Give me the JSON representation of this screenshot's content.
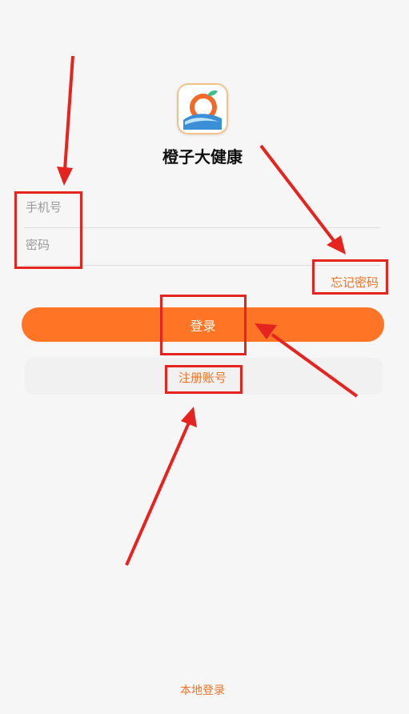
{
  "app": {
    "name": "橙子大健康",
    "logo_icon": "orange-fruit-logo-icon"
  },
  "form": {
    "phone_placeholder": "手机号",
    "password_placeholder": "密码",
    "forgot_label": "忘记密码",
    "login_label": "登录",
    "register_label": "注册账号"
  },
  "footer": {
    "local_login_label": "本地登录"
  },
  "colors": {
    "accent": "#ff7525",
    "link": "#f07326",
    "annotation": "#e5231f",
    "background": "#f7f6f6"
  }
}
